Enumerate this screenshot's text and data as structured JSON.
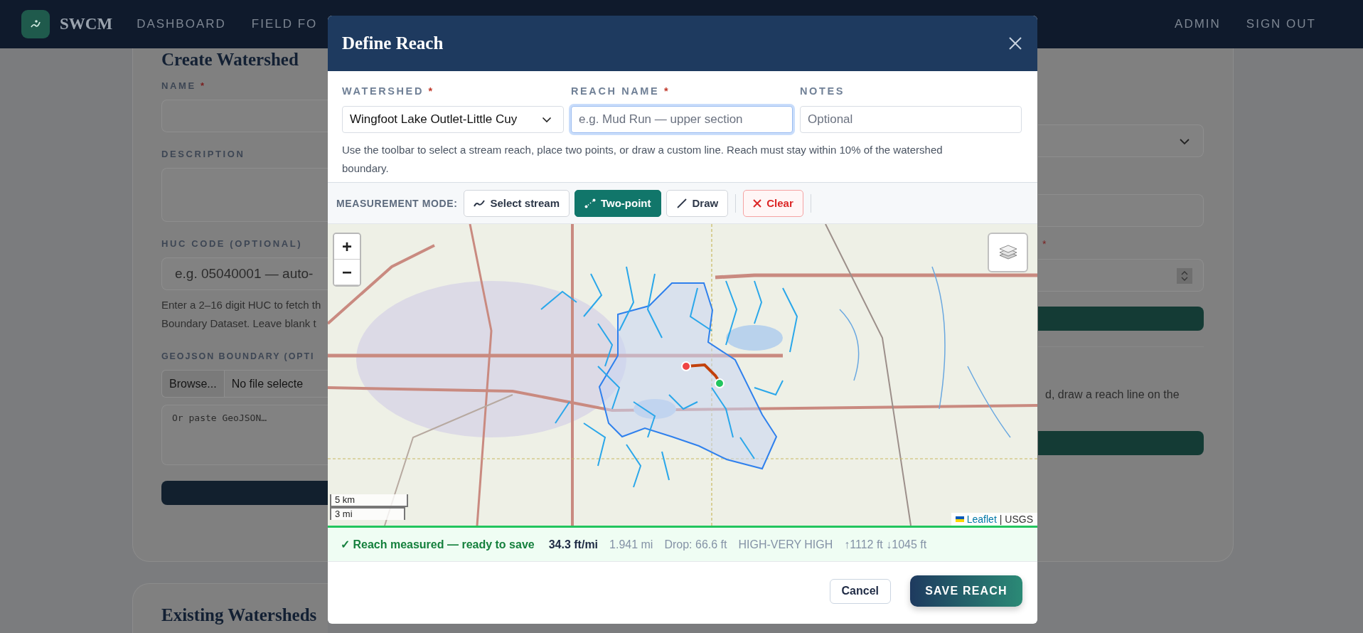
{
  "nav": {
    "logo": "SWCM",
    "links": [
      {
        "label": "DASHBOARD"
      },
      {
        "label": "FIELD FO"
      }
    ],
    "right_links": [
      {
        "label": "ADMIN"
      },
      {
        "label": "SIGN OUT"
      }
    ]
  },
  "create_card": {
    "title": "Create Watershed",
    "name_label": "NAME",
    "name_required": "*",
    "description_label": "DESCRIPTION",
    "huc_label": "HUC CODE (OPTIONAL)",
    "huc_placeholder": "e.g. 05040001 — auto-",
    "huc_help": [
      "Enter a 2–16 digit HUC to fetch th",
      "Boundary Dataset. Leave blank t"
    ],
    "geojson_label": "GEOJSON BOUNDARY (OPTI",
    "browse_button": "Browse...",
    "file_status": "No file selecte",
    "geojson_placeholder": "Or paste GeoJSON…"
  },
  "existing_card": {
    "title": "Existing Watersheds"
  },
  "side_card": {
    "required_mark": "*",
    "hint": "d, draw a reach line on the"
  },
  "modal": {
    "title": "Define Reach",
    "fields": [
      {
        "kind": "select",
        "label": "WATERSHED",
        "required_mark": "*",
        "value": "Wingfoot Lake Outlet-Little Cuy",
        "focused": false
      },
      {
        "kind": "text",
        "label": "REACH NAME",
        "required_mark": "*",
        "placeholder": "e.g. Mud Run — upper section",
        "focused": true
      },
      {
        "kind": "text",
        "label": "NOTES",
        "placeholder": "Optional",
        "focused": false
      }
    ],
    "help": "Use the toolbar to select a stream reach, place two points, or draw a custom line. Reach must stay within 10% of the watershed boundary.",
    "toolbar": {
      "label": "MEASUREMENT MODE:",
      "modes": [
        {
          "kind": "stream",
          "label": "Select stream",
          "selected": false
        },
        {
          "kind": "points",
          "label": "Two-point",
          "selected": true
        },
        {
          "kind": "draw",
          "label": "Draw",
          "selected": false
        }
      ],
      "clear": "Clear"
    },
    "map": {
      "zoom_in": "+",
      "zoom_out": "−",
      "scale": [
        "5 km",
        "3 mi"
      ],
      "attribution_link": "Leaflet",
      "attribution_text": "| USGS"
    },
    "status": {
      "message": "✓ Reach measured — ready to save",
      "gradient": "34.3 ft/mi",
      "length": "1.941 mi",
      "drop": "Drop: 66.6 ft",
      "rating": "HIGH-VERY HIGH",
      "elevation": "↑1112 ft ↓1045 ft"
    },
    "buttons": {
      "cancel": "Cancel",
      "save": "SAVE REACH"
    }
  }
}
